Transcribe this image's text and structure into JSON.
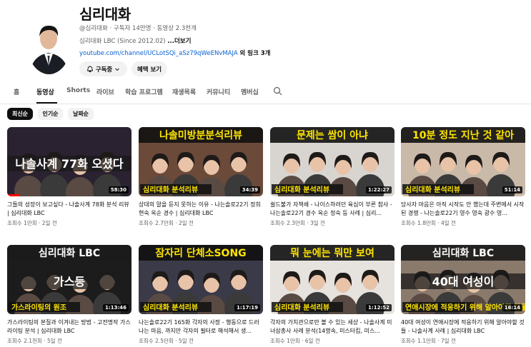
{
  "channel": {
    "name": "심리대화",
    "handle_line": "@심리대화 · 구독자 14만명 · 동영상 2.3천개",
    "description": "심리대화 LBC (Since 2012.02)",
    "more_label": "...더보기",
    "link_url": "youtube.com/channel/UCLotSQi_aSz79qWeENvMAJA",
    "link_extra": "외 링크 3개",
    "subscribe_label": "구독중",
    "perks_label": "혜택 보기"
  },
  "tabs": [
    "홈",
    "동영상",
    "Shorts",
    "라이브",
    "학습 프로그램",
    "재생목록",
    "커뮤니티",
    "멤버십"
  ],
  "active_tab": "동영상",
  "chips": [
    "최신순",
    "인기순",
    "날짜순"
  ],
  "videos": [
    {
      "title": "그들의 성장이 보고싶다 - 나솔사계 78화 분석 리뷰 | 심리대화 LBC",
      "meta": "조회수 1만회 · 2일 전",
      "duration": "58:30",
      "thumb_text_top": "",
      "thumb_text_main": "나솔사계 77화 오셨다",
      "thumb_text_badge": "",
      "progress": 0.1,
      "colors": {
        "bg": "#2a2230",
        "accent": "#ffffff",
        "band": "#1a1a1a"
      }
    },
    {
      "title": "상대의 말을 듣지 못하는 이유 - 나는솔로22기 정희 현숙 옥순 경수 | 심리대화 LBC",
      "meta": "조회수 2.7만회 · 2일 전",
      "duration": "34:39",
      "thumb_text_top": "나솔미방분분석리뷰",
      "thumb_text_main": "",
      "thumb_text_badge": "심리대화 분석리뷰",
      "progress": 0,
      "colors": {
        "bg": "#6b4a3a",
        "accent": "#ffe600",
        "band": "#111111"
      }
    },
    {
      "title": "쉴드불가 자책쇄 - 나이스하려던 육심이 부른 참사 - 나는솔로22기 경수 옥순 정숙 등 사례 | 심리...",
      "meta": "조회수 2.3만회 · 3일 전",
      "duration": "1:22:27",
      "thumb_text_top": "문제는 쌈이 아냐",
      "thumb_text_main": "",
      "thumb_text_badge": "심리대화 분석리뷰",
      "progress": 0,
      "colors": {
        "bg": "#d8d4d0",
        "accent": "#ffe600",
        "band": "#111111"
      }
    },
    {
      "title": "당사자 마음은 아직 시작도 안 했는데 주변에서 시작된 경쟁 - 나는솔로22기 영수 영숙 광수 영...",
      "meta": "조회수 1.8만회 · 4일 전",
      "duration": "51:14",
      "thumb_text_top": "10분 정도 지난 것 같아",
      "thumb_text_main": "",
      "thumb_text_badge": "심리대화 분석리뷰",
      "progress": 0,
      "colors": {
        "bg": "#c9b9a8",
        "accent": "#ffe600",
        "band": "#111111"
      }
    },
    {
      "title": "가스라이팅의 본질과 이겨내는 방법 - 고전명작 가스라이팅 분석 | 심리대화 LBC",
      "meta": "조회수 2.1천회 · 5일 전",
      "duration": "1:13:46",
      "thumb_text_top": "심리대화 LBC",
      "thumb_text_main": "가스등",
      "thumb_text_badge": "가스라이팅의 원조",
      "progress": 0,
      "colors": {
        "bg": "#1c1c1c",
        "accent": "#ffffff",
        "band": "#1c1c1c"
      }
    },
    {
      "title": "나는솔로22기 165화 각자의 사정 - 행동으로 드러나는 마음, 까지만 각자의 필터로 해석해서 생...",
      "meta": "조회수 2.5만회 · 5일 전",
      "duration": "1:17:19",
      "thumb_text_top": "잠자리 단체소SONG",
      "thumb_text_main": "",
      "thumb_text_badge": "심리대화 분석리뷰",
      "progress": 0,
      "colors": {
        "bg": "#3a3a48",
        "accent": "#ffe600",
        "band": "#111111"
      }
    },
    {
      "title": "각자의 가치관으로만 볼 수 있는 세상 - 나솔사계 미녀삼총사 사례 분석(14명속, 미스터킴, 미스...",
      "meta": "조회수 1만회 · 6일 전",
      "duration": "1:12:52",
      "thumb_text_top": "뭐 눈에는 뭐만 보여",
      "thumb_text_main": "",
      "thumb_text_badge": "심리대화 분석리뷰",
      "progress": 0,
      "colors": {
        "bg": "#e6e2de",
        "accent": "#ffe600",
        "band": "#111111"
      }
    },
    {
      "title": "40대 여성이 연애시장에 적응하기 위해 알아야할 것들 - 나솔사계 사례 | 심리대화 LBC",
      "meta": "조회수 1.1만회 · 7일 전",
      "duration": "16:14",
      "thumb_text_top": "심리대화 LBC",
      "thumb_text_main": "40대 여성이",
      "thumb_text_badge": "연애시장에 적응하기 위해 알아야할 것들",
      "progress": 0,
      "colors": {
        "bg": "#8a7a6c",
        "accent": "#ffffff",
        "band": "#1a1a1a"
      }
    }
  ]
}
